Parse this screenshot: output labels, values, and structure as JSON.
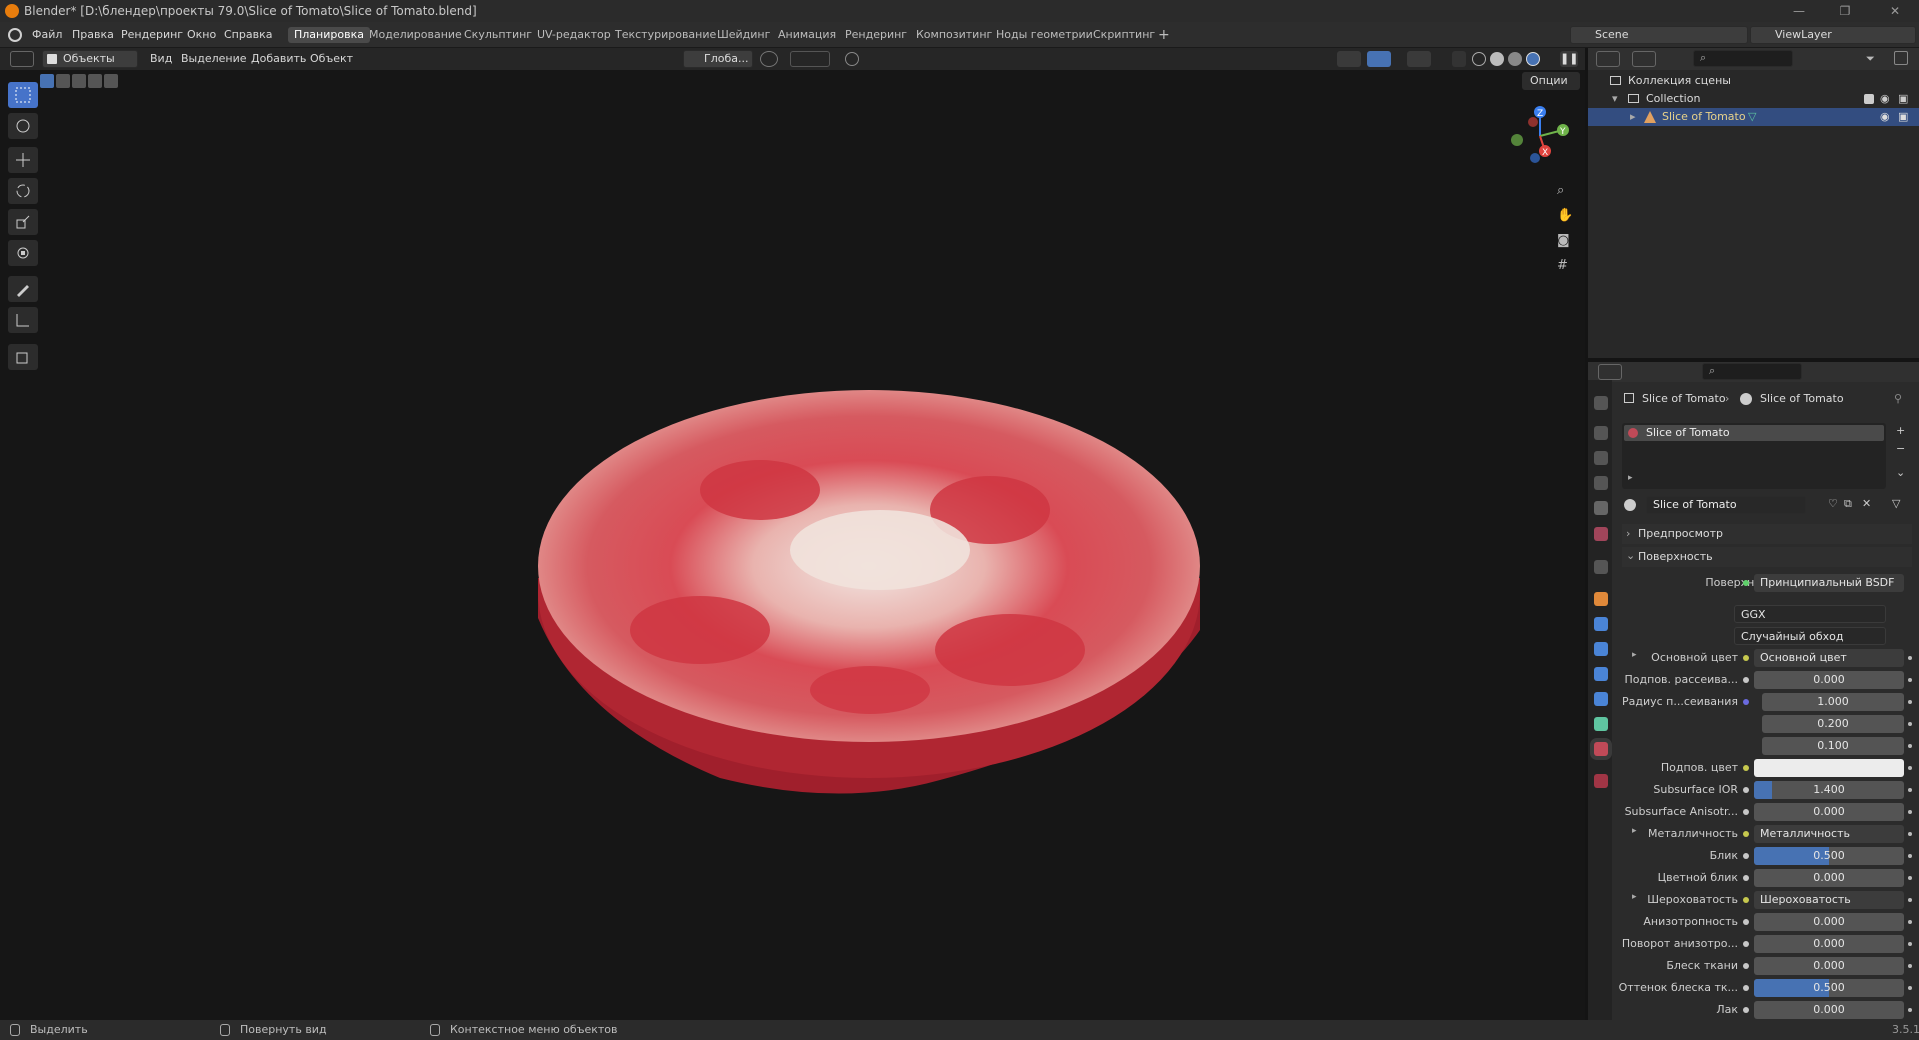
{
  "window": {
    "title": "Blender* [D:\\блендер\\проекты 79.0\\Slice of Tomato\\Slice of Tomato.blend]"
  },
  "menu": [
    "Файл",
    "Правка",
    "Рендеринг",
    "Окно",
    "Справка"
  ],
  "workspaces": [
    "Планировка",
    "Моделирование",
    "Скульптинг",
    "UV-редактор",
    "Текстурирование",
    "Шейдинг",
    "Анимация",
    "Рендеринг",
    "Композитинг",
    "Ноды геометрии",
    "Скриптинг"
  ],
  "scene": {
    "name": "Scene",
    "view_layer": "ViewLayer"
  },
  "viewport_header": {
    "mode": "Объекты",
    "menus": [
      "Вид",
      "Выделение",
      "Добавить",
      "Объект"
    ],
    "orientation": "Глоба...",
    "options": "Опции"
  },
  "outliner": {
    "root": "Коллекция сцены",
    "collection": "Collection",
    "object": "Slice of Tomato"
  },
  "properties": {
    "breadcrumb_object": "Slice of Tomato",
    "breadcrumb_material": "Slice of Tomato",
    "slot_name": "Slice of Tomato",
    "material_name": "Slice of Tomato",
    "panel_preview": "Предпросмотр",
    "panel_surface": "Поверхность",
    "surface_label": "Поверхность",
    "surface_value": "Принципиальный BSDF",
    "distribution": "GGX",
    "subsurface_method": "Случайный обход",
    "rows": [
      {
        "label": "Основной цвет",
        "value": "Основной цвет",
        "kind": "link",
        "expand": true
      },
      {
        "label": "Подпов. рассеива...",
        "value": "0.000",
        "kind": "num",
        "fill": 0
      },
      {
        "label": "Радиус п...сеивания",
        "value": "1.000",
        "kind": "vec"
      },
      {
        "label": "",
        "value": "0.200",
        "kind": "vec"
      },
      {
        "label": "",
        "value": "0.100",
        "kind": "vec"
      },
      {
        "label": "Подпов. цвет",
        "value": "",
        "kind": "color"
      },
      {
        "label": "Subsurface IOR",
        "value": "1.400",
        "kind": "num",
        "fill": 0.12
      },
      {
        "label": "Subsurface Anisotr...",
        "value": "0.000",
        "kind": "num",
        "fill": 0
      },
      {
        "label": "Металличность",
        "value": "Металличность",
        "kind": "link",
        "expand": true
      },
      {
        "label": "Блик",
        "value": "0.500",
        "kind": "num",
        "fill": 0.5
      },
      {
        "label": "Цветной блик",
        "value": "0.000",
        "kind": "num",
        "fill": 0
      },
      {
        "label": "Шероховатость",
        "value": "Шероховатость",
        "kind": "link",
        "expand": true
      },
      {
        "label": "Анизотропность",
        "value": "0.000",
        "kind": "num",
        "fill": 0
      },
      {
        "label": "Поворот анизотро...",
        "value": "0.000",
        "kind": "num",
        "fill": 0
      },
      {
        "label": "Блеск ткани",
        "value": "0.000",
        "kind": "num",
        "fill": 0
      },
      {
        "label": "Оттенок блеска тк...",
        "value": "0.500",
        "kind": "num",
        "fill": 0.5
      },
      {
        "label": "Лак",
        "value": "0.000",
        "kind": "num",
        "fill": 0
      }
    ]
  },
  "status": {
    "select": "Выделить",
    "rotate": "Повернуть вид",
    "context": "Контекстное меню объектов",
    "version": "3.5.1"
  },
  "colors": {
    "accent": "#4772b3",
    "tomato_side": "#a8202c",
    "tomato_top": "#d9525a",
    "tomato_core": "#efe3df"
  }
}
